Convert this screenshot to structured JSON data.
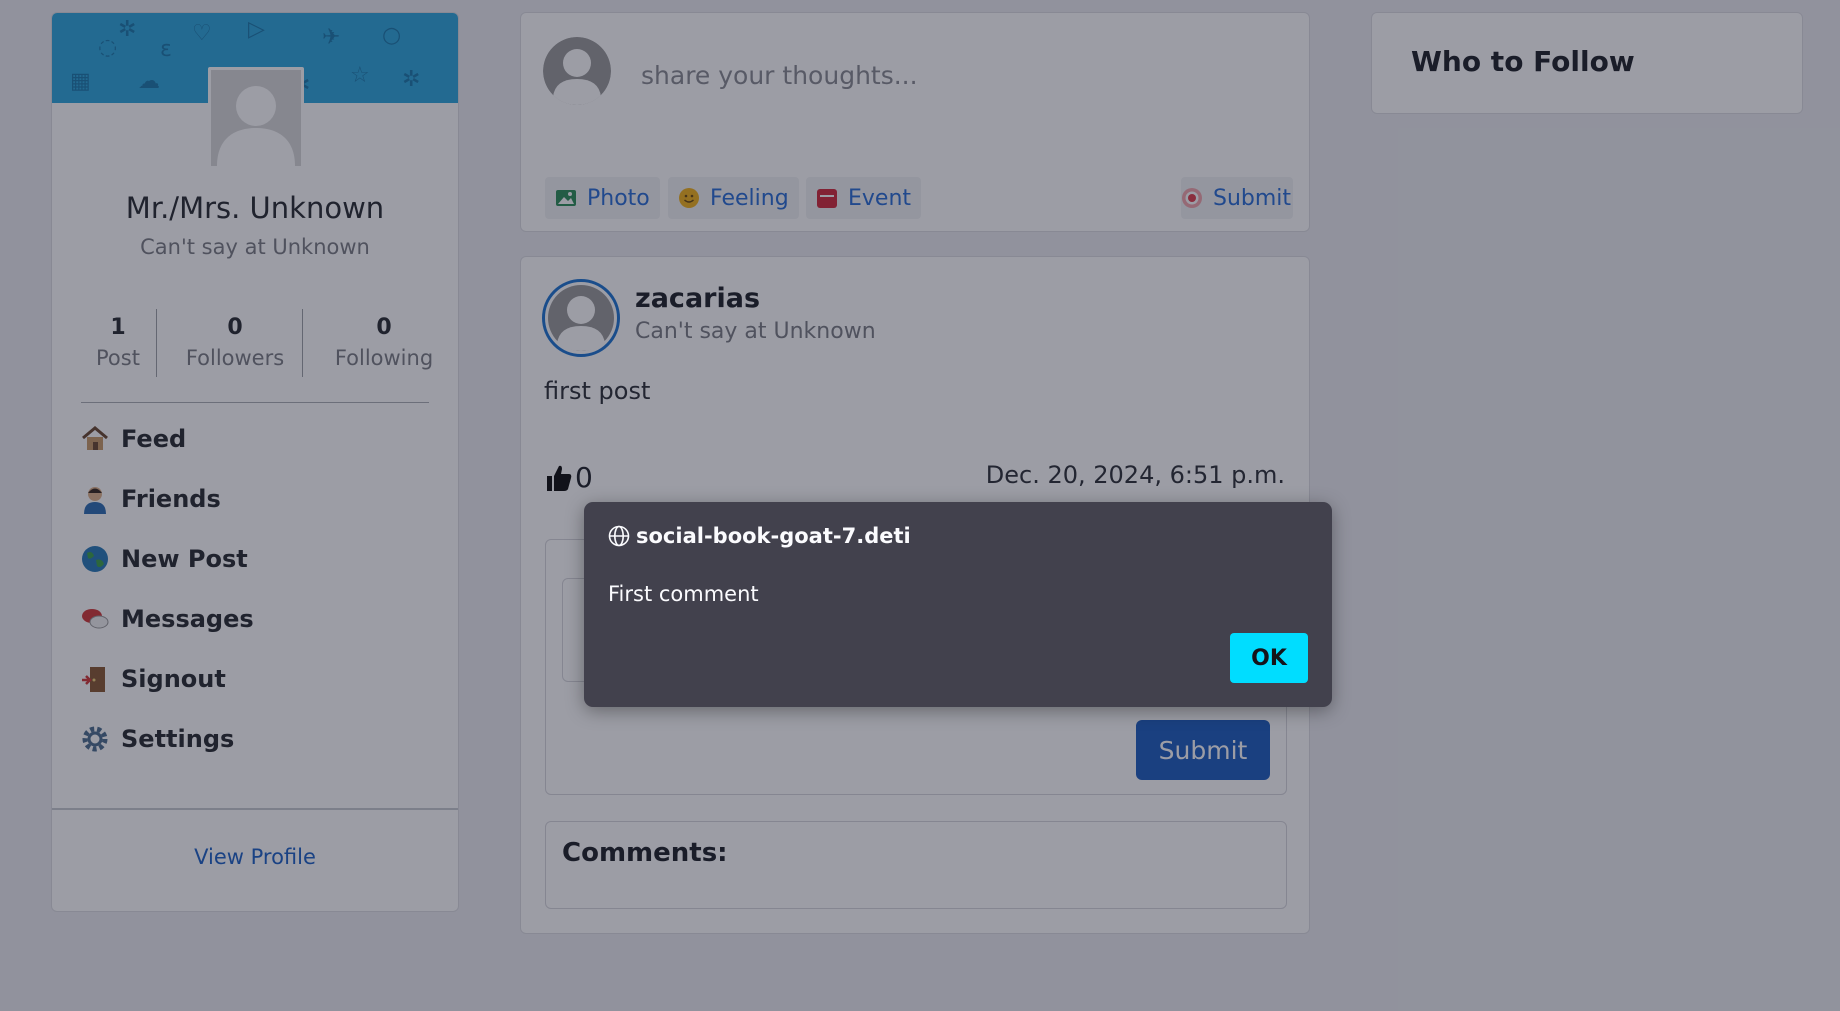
{
  "profile": {
    "name": "Mr./Mrs. Unknown",
    "subtitle": "Can't say at Unknown",
    "stats": [
      {
        "num": "1",
        "label": "Post"
      },
      {
        "num": "0",
        "label": "Followers"
      },
      {
        "num": "0",
        "label": "Following"
      }
    ],
    "nav": [
      {
        "label": "Feed",
        "icon": "house-icon"
      },
      {
        "label": "Friends",
        "icon": "person-icon"
      },
      {
        "label": "New Post",
        "icon": "globe-icon"
      },
      {
        "label": "Messages",
        "icon": "speech-bubbles-icon"
      },
      {
        "label": "Signout",
        "icon": "door-icon"
      },
      {
        "label": "Settings",
        "icon": "gear-icon"
      }
    ],
    "view_profile": "View Profile"
  },
  "composer": {
    "placeholder": "share your thoughts...",
    "photo": "Photo",
    "feeling": "Feeling",
    "event": "Event",
    "submit": "Submit"
  },
  "post": {
    "author": "zacarias",
    "subtitle": "Can't say at Unknown",
    "text": "first post",
    "likes": "0",
    "date": "Dec. 20, 2024, 6:51 p.m.",
    "comment_submit": "Submit",
    "comments_title": "Comments:"
  },
  "sidebar_right": {
    "who_to_follow": "Who to Follow"
  },
  "dialog": {
    "origin": "social-book-goat-7.deti",
    "message": "First comment",
    "ok": "OK"
  },
  "colors": {
    "primary": "#1f5fc0",
    "link": "#1f63c6",
    "cover": "#2fa8dd",
    "dialog_bg": "#42414d",
    "dialog_button": "#00ddff"
  }
}
